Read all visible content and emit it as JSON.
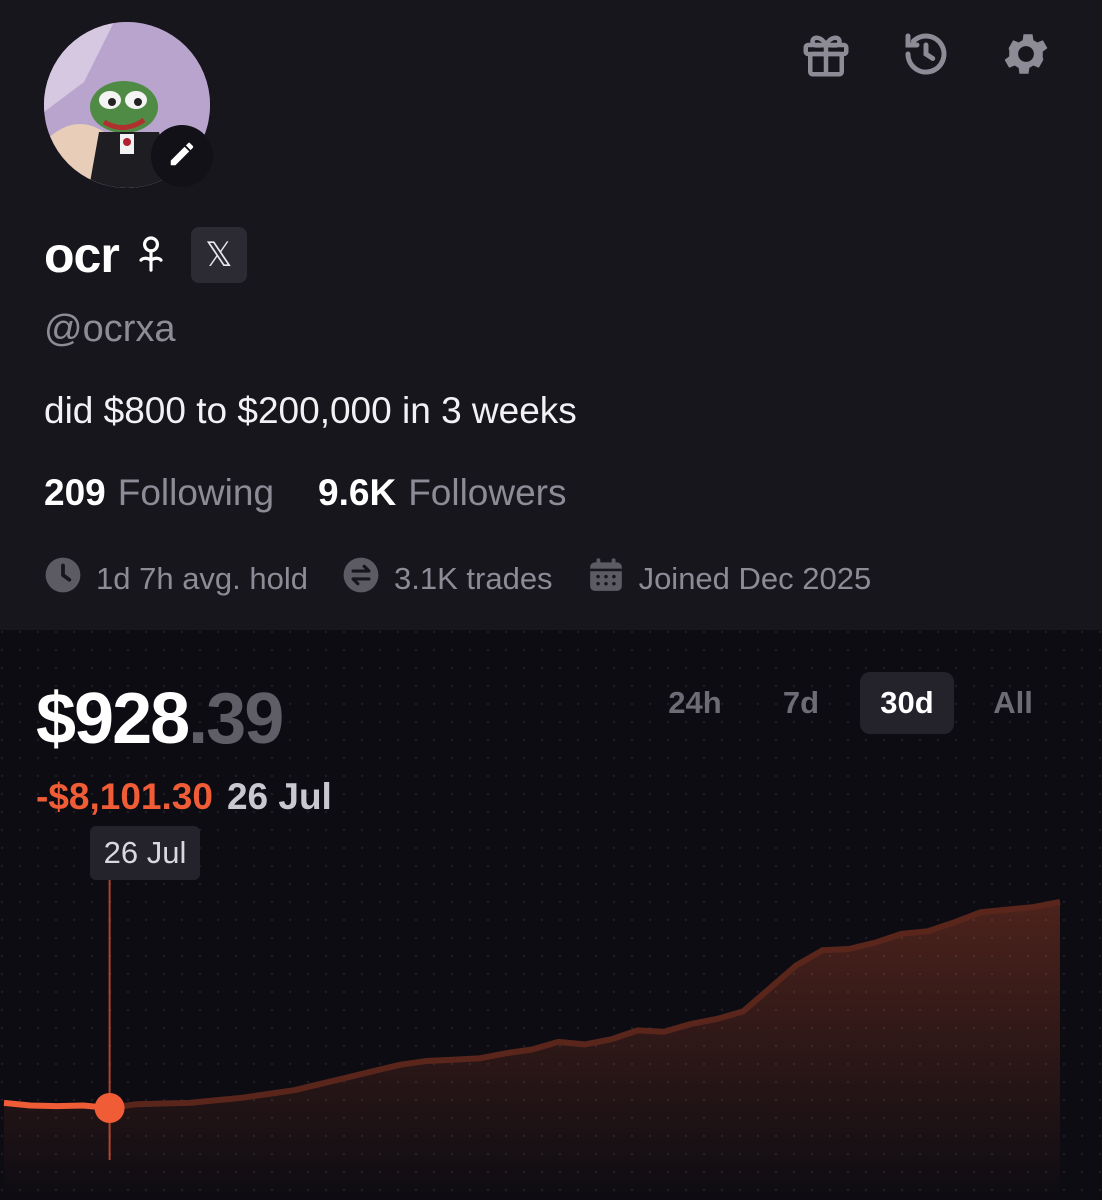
{
  "profile": {
    "name": "ocr",
    "handle": "@ocrxa",
    "bio": "did $800 to $200,000 in 3 weeks",
    "following_count": "209",
    "following_label": "Following",
    "followers_count": "9.6K",
    "followers_label": "Followers",
    "avg_hold": "1d 7h avg. hold",
    "trades": "3.1K trades",
    "joined": "Joined Dec 2025",
    "x_badge": "𝕏"
  },
  "icons": [
    "gift-icon",
    "history-icon",
    "gear-icon",
    "edit-icon",
    "sprout-icon",
    "clock-icon",
    "swap-icon",
    "calendar-icon"
  ],
  "balance": {
    "whole": "$928",
    "cents": ".39",
    "change": "-$8,101.30",
    "change_date": "26 Jul",
    "tooltip_date": "26 Jul"
  },
  "ranges": [
    {
      "label": "24h",
      "active": false
    },
    {
      "label": "7d",
      "active": false
    },
    {
      "label": "30d",
      "active": true
    },
    {
      "label": "All",
      "active": false
    }
  ],
  "colors": {
    "accent": "#ef5c36",
    "background": "#17161d",
    "chart_background": "#0d0c12",
    "muted_text": "#8d8c96"
  },
  "chart_data": {
    "type": "line",
    "selected_point_index": 4,
    "values": [
      1000,
      980,
      975,
      980,
      960,
      990,
      995,
      1000,
      1020,
      1040,
      1070,
      1100,
      1150,
      1200,
      1250,
      1300,
      1330,
      1340,
      1350,
      1390,
      1420,
      1480,
      1460,
      1500,
      1570,
      1560,
      1620,
      1660,
      1720,
      1900,
      2080,
      2200,
      2210,
      2260,
      2330,
      2350,
      2420,
      2500,
      2520,
      2540,
      2580
    ]
  }
}
